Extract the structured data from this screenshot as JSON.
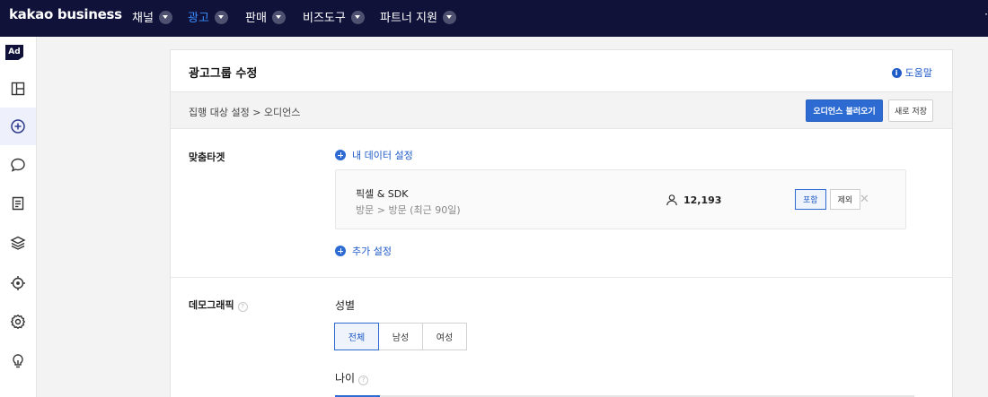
{
  "app": {
    "logo": "kakao business"
  },
  "nav": [
    {
      "label": "채널",
      "active": false
    },
    {
      "label": "광고",
      "active": true
    },
    {
      "label": "판매",
      "active": false
    },
    {
      "label": "비즈도구",
      "active": false
    },
    {
      "label": "파트너 지원",
      "active": false
    }
  ],
  "sidebar": {
    "badge": "Ad",
    "icons": [
      "layout-icon",
      "plus-circle-icon",
      "chat-icon",
      "document-icon",
      "layers-icon",
      "target-icon",
      "settings-icon",
      "lightbulb-icon"
    ],
    "active_icon": "plus-circle-icon"
  },
  "page": {
    "title": "광고그룹 수정",
    "help_label": "도움말"
  },
  "breadcrumb": {
    "text": "집행 대상 설정 > 오디언스",
    "load_audience_button": "오디언스 불러오기",
    "save_new_button": "새로 저장"
  },
  "custom_target": {
    "label": "맞춤타겟",
    "my_data_link": "내 데이터 설정",
    "item": {
      "name": "픽셀 & SDK",
      "detail": "방문 > 방문 (최근 90일)",
      "count": "12,193",
      "include_label": "포함",
      "exclude_label": "제외",
      "selected": "포함",
      "remove_icon": "close-icon"
    },
    "add_setting_link": "추가 설정"
  },
  "demographic": {
    "label": "데모그래픽",
    "help_icon": "question-icon",
    "gender": {
      "label": "성별",
      "options": [
        "전체",
        "남성",
        "여성"
      ],
      "selected": "전체"
    },
    "age": {
      "label": "나이"
    }
  },
  "colors": {
    "topbar": "#10123a",
    "accent": "#2d6bd3",
    "active_nav": "#3a8dff"
  }
}
